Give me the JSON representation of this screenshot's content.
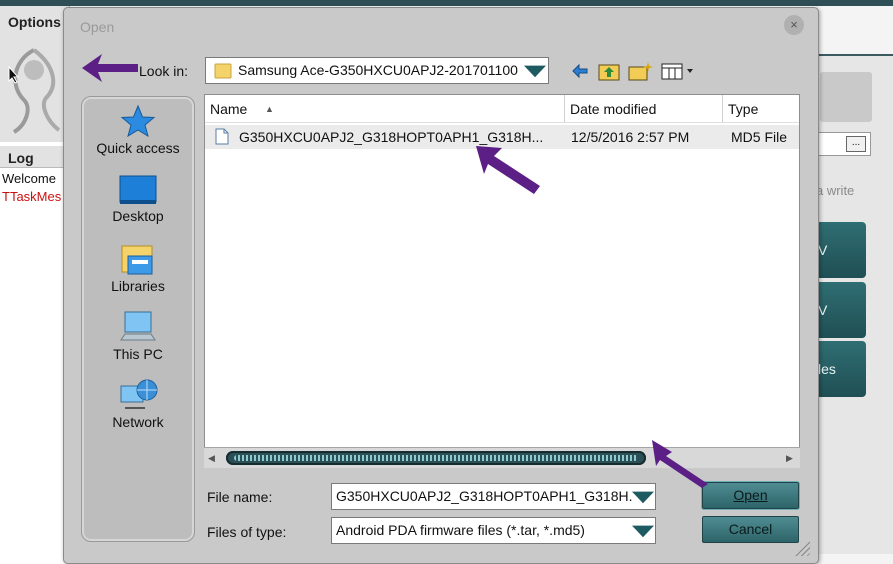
{
  "background_app": {
    "options_label": "Options",
    "log_label": "Log",
    "log_lines": [
      "Welcome",
      "TTaskMes"
    ],
    "right_panel_text": "a write",
    "right_buttons": [
      "V",
      "V",
      "les"
    ]
  },
  "dialog": {
    "title": "Open",
    "close_symbol": "×",
    "look_in": {
      "label": "Look in:",
      "value": "Samsung Ace-G350HXCU0APJ2-201701100"
    },
    "toolbar_icons": [
      "back-arrow-icon",
      "up-folder-icon",
      "new-folder-icon",
      "view-menu-icon"
    ],
    "places": [
      {
        "label": "Quick access",
        "icon": "star-icon"
      },
      {
        "label": "Desktop",
        "icon": "desktop-icon"
      },
      {
        "label": "Libraries",
        "icon": "libraries-icon"
      },
      {
        "label": "This PC",
        "icon": "computer-icon"
      },
      {
        "label": "Network",
        "icon": "network-icon"
      }
    ],
    "file_list": {
      "columns": [
        "Name",
        "Date modified",
        "Type"
      ],
      "rows": [
        {
          "name": "G350HXCU0APJ2_G318HOPT0APH1_G318H...",
          "date_modified": "12/5/2016 2:57 PM",
          "type": "MD5 File"
        }
      ]
    },
    "file_name": {
      "label": "File name:",
      "value": "G350HXCU0APJ2_G318HOPT0APH1_G318H."
    },
    "file_type": {
      "label": "Files of type:",
      "value": "Android PDA firmware files (*.tar, *.md5)"
    },
    "buttons": {
      "open": "Open",
      "cancel": "Cancel"
    },
    "colors": {
      "accent": "#2d6469",
      "annotation_arrow": "#5b1f86",
      "error_text": "#cc1111"
    }
  }
}
